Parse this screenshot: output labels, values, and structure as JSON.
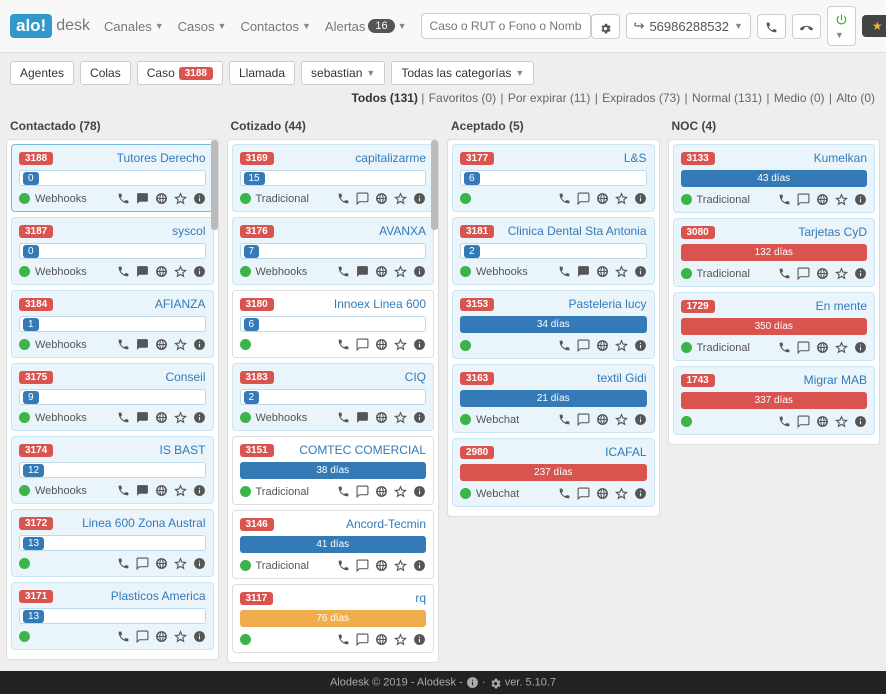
{
  "brand": {
    "logo": "alo!",
    "rest": "desk"
  },
  "nav": {
    "canales": "Canales",
    "casos": "Casos",
    "contactos": "Contactos",
    "alertas": "Alertas",
    "alertas_badge": "16",
    "search_ph": "Caso o RUT o Fono o Nombr"
  },
  "navright": {
    "phone": "56986288532",
    "user": "sebastian"
  },
  "toolbar": {
    "agentes": "Agentes",
    "colas": "Colas",
    "caso": "Caso",
    "caso_badge": "3188",
    "llamada": "Llamada",
    "user": "sebastian",
    "cats": "Todas las categorías"
  },
  "filters": {
    "todos": "Todos (131)",
    "fav": "Favoritos (0)",
    "exp": "Por expirar (11)",
    "expd": "Expirados (73)",
    "norm": "Normal (131)",
    "med": "Medio (0)",
    "alto": "Alto (0)"
  },
  "cols": [
    {
      "title": "Contactado (78)",
      "scroll": true,
      "cards": [
        {
          "id": "3188",
          "title": "Tutores Derecho",
          "num": "0",
          "src": "Webhooks",
          "fill": true,
          "hl": true
        },
        {
          "id": "3187",
          "title": "syscol",
          "num": "0",
          "src": "Webhooks",
          "fill": true
        },
        {
          "id": "3184",
          "title": "AFIANZA",
          "num": "1",
          "src": "Webhooks",
          "fill": true
        },
        {
          "id": "3175",
          "title": "Conseil",
          "num": "9",
          "src": "Webhooks",
          "fill": true
        },
        {
          "id": "3174",
          "title": "IS BAST",
          "num": "12",
          "src": "Webhooks",
          "fill": true
        },
        {
          "id": "3172",
          "title": "Linea 600 Zona Austral",
          "num": "13",
          "src": ""
        },
        {
          "id": "3171",
          "title": "Plasticos America",
          "num": "13",
          "src": ""
        }
      ]
    },
    {
      "title": "Cotizado (44)",
      "scroll": true,
      "cards": [
        {
          "id": "3169",
          "title": "capitalizarme",
          "num": "15",
          "src": "Tradicional"
        },
        {
          "id": "3176",
          "title": "AVANXA",
          "num": "7",
          "src": "Webhooks",
          "fill": true
        },
        {
          "id": "3180",
          "title": "Innoex Linea 600",
          "num": "6",
          "src": "",
          "white": true
        },
        {
          "id": "3183",
          "title": "CIQ",
          "num": "2",
          "src": "Webhooks",
          "fill": true
        },
        {
          "id": "3151",
          "title": "COMTEC COMERCIAL",
          "days": "38 días",
          "dclass": "days-blue",
          "src": "Tradicional",
          "white": true
        },
        {
          "id": "3146",
          "title": "Ancord-Tecmin",
          "days": "41 días",
          "dclass": "days-blue",
          "src": "Tradicional",
          "white": true
        },
        {
          "id": "3117",
          "title": "rq",
          "days": "76 días",
          "dclass": "days-orange",
          "src": "",
          "white": true
        }
      ]
    },
    {
      "title": "Aceptado (5)",
      "cards": [
        {
          "id": "3177",
          "title": "L&S",
          "num": "6",
          "src": ""
        },
        {
          "id": "3181",
          "title": "Clinica Dental Sta Antonia",
          "num": "2",
          "src": "Webhooks",
          "fill": true
        },
        {
          "id": "3153",
          "title": "Pasteleria lucy",
          "days": "34 días",
          "dclass": "days-blue",
          "src": ""
        },
        {
          "id": "3163",
          "title": "textil Gidi",
          "days": "21 días",
          "dclass": "days-blue",
          "src": "Webchat"
        },
        {
          "id": "2980",
          "title": "ICAFAL",
          "days": "237 días",
          "dclass": "days-red",
          "src": "Webchat"
        }
      ]
    },
    {
      "title": "NOC (4)",
      "cards": [
        {
          "id": "3133",
          "title": "Kumelkan",
          "days": "43 días",
          "dclass": "days-blue",
          "src": "Tradicional"
        },
        {
          "id": "3080",
          "title": "Tarjetas CyD",
          "days": "132 días",
          "dclass": "days-red",
          "src": "Tradicional"
        },
        {
          "id": "1729",
          "title": "En mente",
          "days": "350 días",
          "dclass": "days-red",
          "src": "Tradicional"
        },
        {
          "id": "1743",
          "title": "Migrar MAB",
          "days": "337 días",
          "dclass": "days-red",
          "src": ""
        }
      ]
    }
  ],
  "footer": {
    "copy": "Alodesk © 2019 - Alodesk -",
    "ver": "ver. 5.10.7"
  }
}
